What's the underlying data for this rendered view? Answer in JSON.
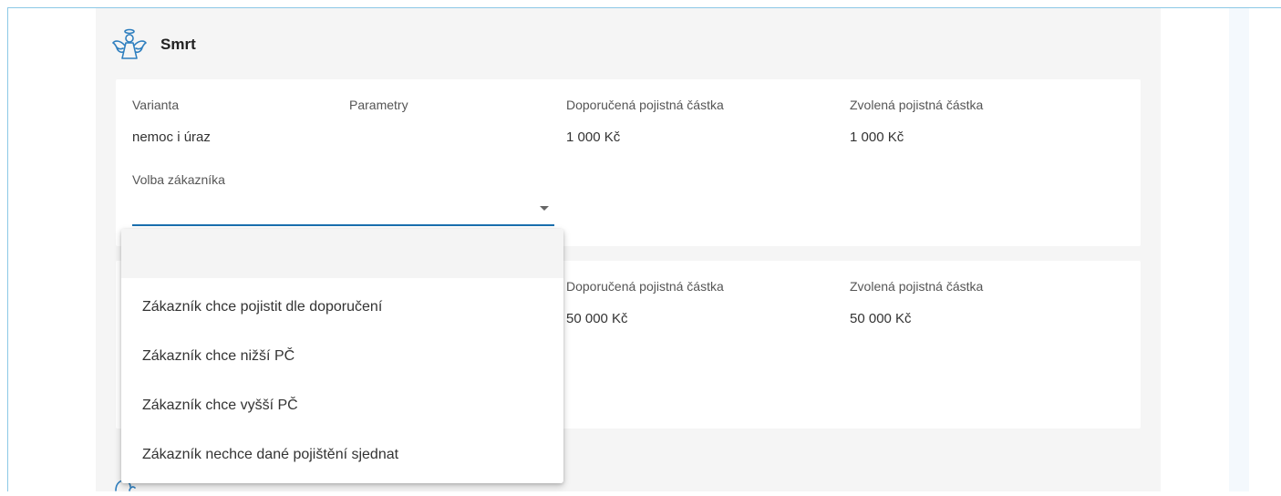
{
  "section": {
    "title": "Smrt",
    "icon": "angel-icon",
    "accent_color": "#2f7fbf"
  },
  "card1": {
    "variant_label": "Varianta",
    "variant_value": "nemoc i úraz",
    "params_label": "Parametry",
    "recommended_label": "Doporučená pojistná částka",
    "recommended_value": "1 000 Kč",
    "chosen_label": "Zvolená pojistná částka",
    "chosen_value": "1 000 Kč",
    "customer_choice_label": "Volba zákazníka",
    "customer_choice_value": ""
  },
  "card2": {
    "recommended_label": "Doporučená pojistná částka",
    "recommended_value": "50 000 Kč",
    "chosen_label": "Zvolená pojistná částka",
    "chosen_value": "50 000 Kč"
  },
  "dropdown": {
    "options": [
      "",
      "Zákazník chce pojistit dle doporučení",
      "Zákazník chce nižší PČ",
      "Zákazník chce vyšší PČ",
      "Zákazník nechce dané pojištění sjednat"
    ]
  }
}
